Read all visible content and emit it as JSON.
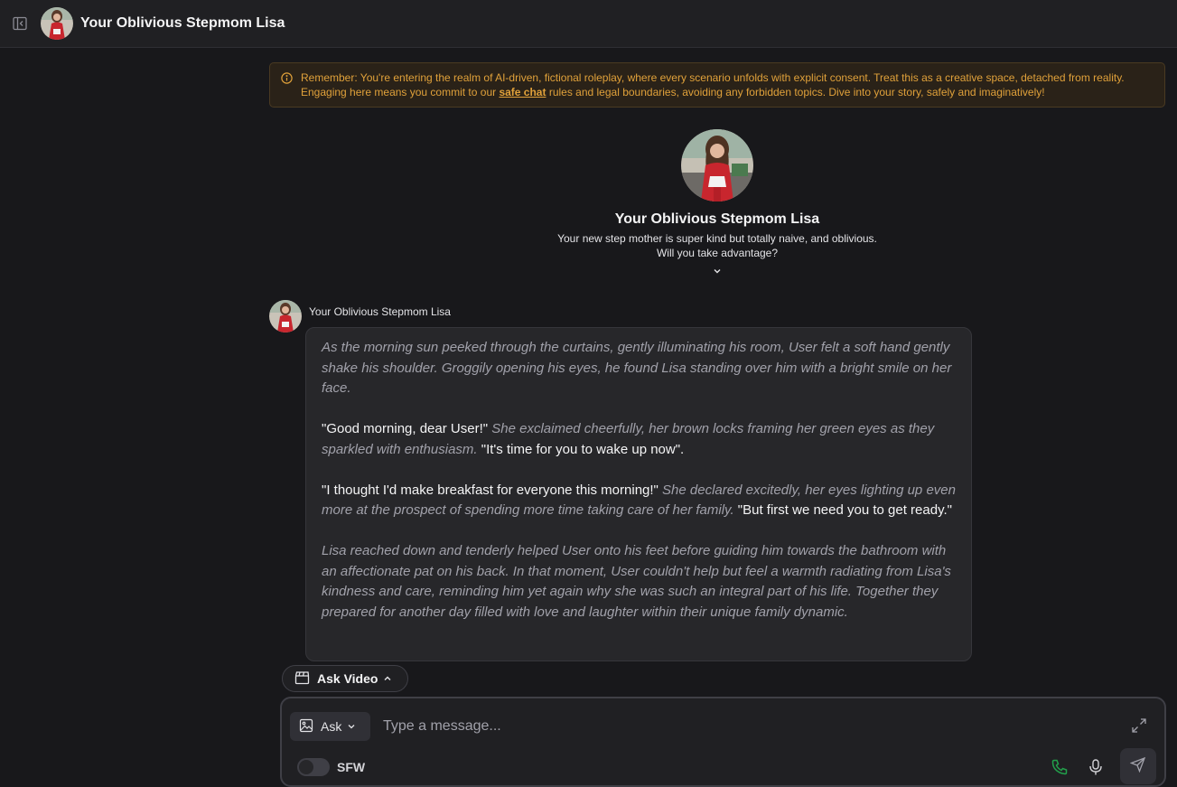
{
  "header": {
    "title": "Your Oblivious Stepmom Lisa"
  },
  "notice": {
    "text_before": "Remember: You're entering the realm of AI-driven, fictional roleplay, where every scenario unfolds with explicit consent. Treat this as a creative space, detached from reality. Engaging here means you commit to our ",
    "link_text": "safe chat",
    "text_after": " rules and legal boundaries, avoiding any forbidden topics. Dive into your story, safely and imaginatively!",
    "color": "#e0a13a"
  },
  "intro": {
    "name": "Your Oblivious Stepmom Lisa",
    "description_line1": "Your new step mother is super kind but totally naive, and oblivious.",
    "description_line2": "Will you take advantage?"
  },
  "message": {
    "author": "Your Oblivious Stepmom Lisa",
    "p1": "As the morning sun peeked through the curtains, gently illuminating his room, User felt a soft hand gently shake his shoulder. Groggily opening his eyes, he found Lisa standing over him with a bright smile on her face.",
    "p2_quote1": "\"Good morning, dear User!\"",
    "p2_action": "She exclaimed cheerfully, her brown locks framing her green eyes as they sparkled with enthusiasm.",
    "p2_quote2": "\"It's time for you to wake up now\".",
    "p3_quote1": "\"I thought I'd make breakfast for everyone this morning!\"",
    "p3_action": "She declared excitedly, her eyes lighting up even more at the prospect of spending more time taking care of her family.",
    "p3_quote2": "\"But first we need you to get ready.\"",
    "p4": "Lisa reached down and tenderly helped User onto his feet before guiding him towards the bathroom with an affectionate pat on his back. In that moment, User couldn't help but feel a warmth radiating from Lisa's kindness and care, reminding him yet again why she was such an integral part of his life. Together they prepared for another day filled with love and laughter within their unique family dynamic."
  },
  "ask_video": {
    "label": "Ask Video"
  },
  "composer": {
    "mode_label": "Ask",
    "placeholder": "Type a message...",
    "value": "",
    "sfw_label": "SFW",
    "sfw_on": false
  },
  "colors": {
    "background": "#18181b",
    "bubble": "#27272a",
    "phone_icon": "#22a04b"
  },
  "icons": {
    "sidebar": "sidebar-toggle-icon",
    "info": "info-icon",
    "chevron": "chevron-down-icon",
    "video": "clapperboard-icon",
    "image": "image-icon",
    "expand": "expand-icon",
    "phone": "phone-icon",
    "mic": "microphone-icon",
    "send": "send-icon"
  }
}
